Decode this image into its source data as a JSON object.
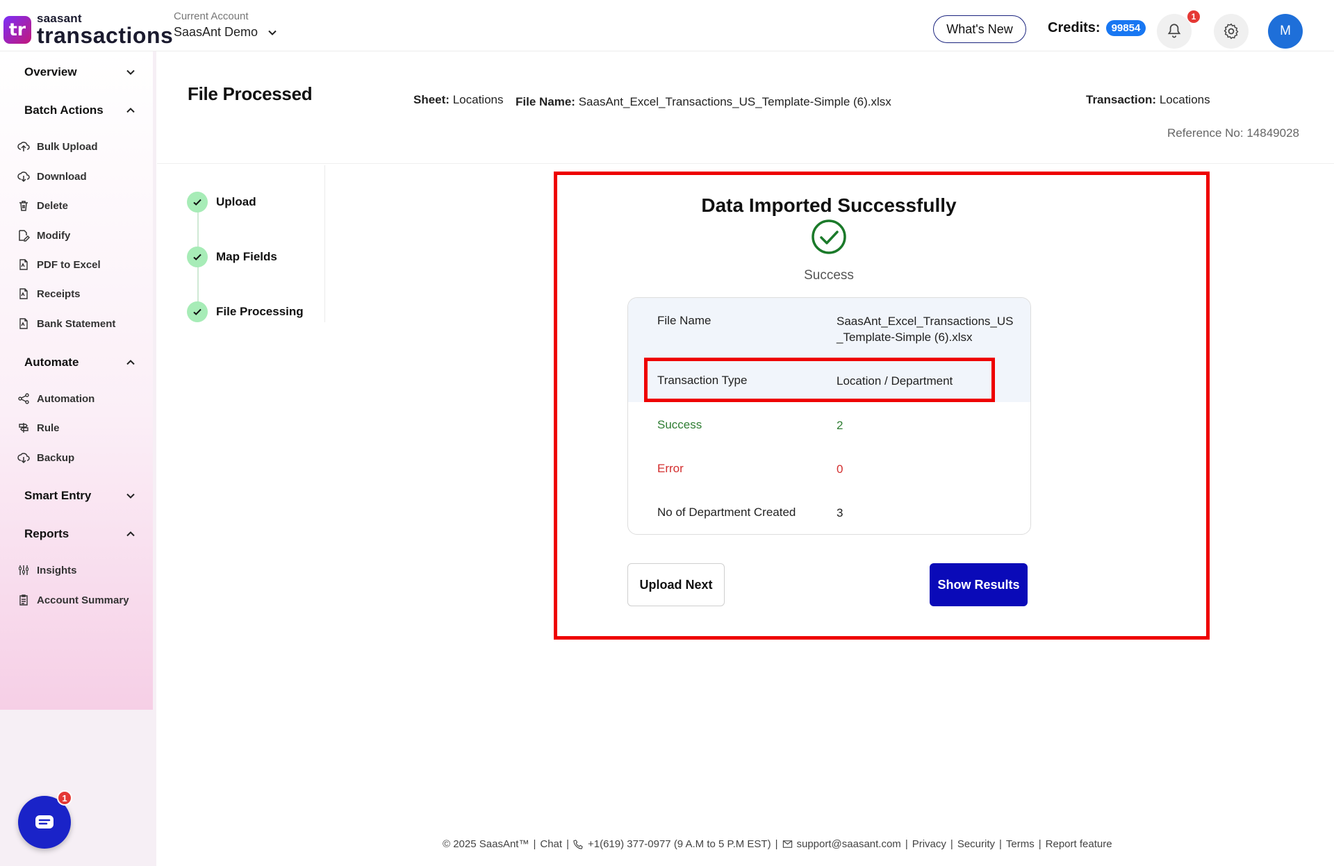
{
  "header": {
    "logo_mark": "tr",
    "logo_small": "saasant",
    "logo_big": "transactions",
    "account_label": "Current Account",
    "account_value": "SaasAnt Demo",
    "whats_new": "What's New",
    "credits_label": "Credits:",
    "credits_value": "99854",
    "notification_count": "1",
    "avatar_initial": "M"
  },
  "sidebar": {
    "overview": "Overview",
    "batch_actions": "Batch Actions",
    "batch_items": [
      "Bulk Upload",
      "Download",
      "Delete",
      "Modify",
      "PDF to Excel",
      "Receipts",
      "Bank Statement"
    ],
    "automate": "Automate",
    "automate_items": [
      "Automation",
      "Rule",
      "Backup"
    ],
    "smart_entry": "Smart Entry",
    "reports": "Reports",
    "report_items": [
      "Insights",
      "Account Summary"
    ],
    "chat_badge": "1"
  },
  "page": {
    "title": "File Processed",
    "sheet_label": "Sheet:",
    "sheet_value": "Locations",
    "file_label": "File Name:",
    "file_value": "SaasAnt_Excel_Transactions_US_Template-Simple (6).xlsx",
    "transaction_label": "Transaction:",
    "transaction_value": "Locations",
    "reference": "Reference No: 14849028"
  },
  "steps": [
    "Upload",
    "Map Fields",
    "File Processing"
  ],
  "result": {
    "title": "Data Imported Successfully",
    "status": "Success",
    "rows": [
      {
        "label": "File Name",
        "value": "SaasAnt_Excel_Transactions_US_Template-Simple (6).xlsx"
      },
      {
        "label": "Transaction Type",
        "value": "Location / Department"
      },
      {
        "label": "Success",
        "value": "2"
      },
      {
        "label": "Error",
        "value": "0"
      },
      {
        "label": "No of Department Created",
        "value": "3"
      }
    ],
    "upload_next": "Upload Next",
    "show_results": "Show Results"
  },
  "footer": {
    "copyright": "© 2025 SaasAnt™",
    "chat": "Chat",
    "phone": "+1(619) 377-0977 (9 A.M to 5 P.M EST)",
    "email": "support@saasant.com",
    "privacy": "Privacy",
    "security": "Security",
    "terms": "Terms",
    "report_feature": "Report feature"
  },
  "colors": {
    "accent_blue": "#0a0ab8",
    "success_green": "#2e7d32",
    "error_red": "#d32f2f",
    "highlight_red": "#ee0000",
    "credits_badge": "#1877f2"
  }
}
